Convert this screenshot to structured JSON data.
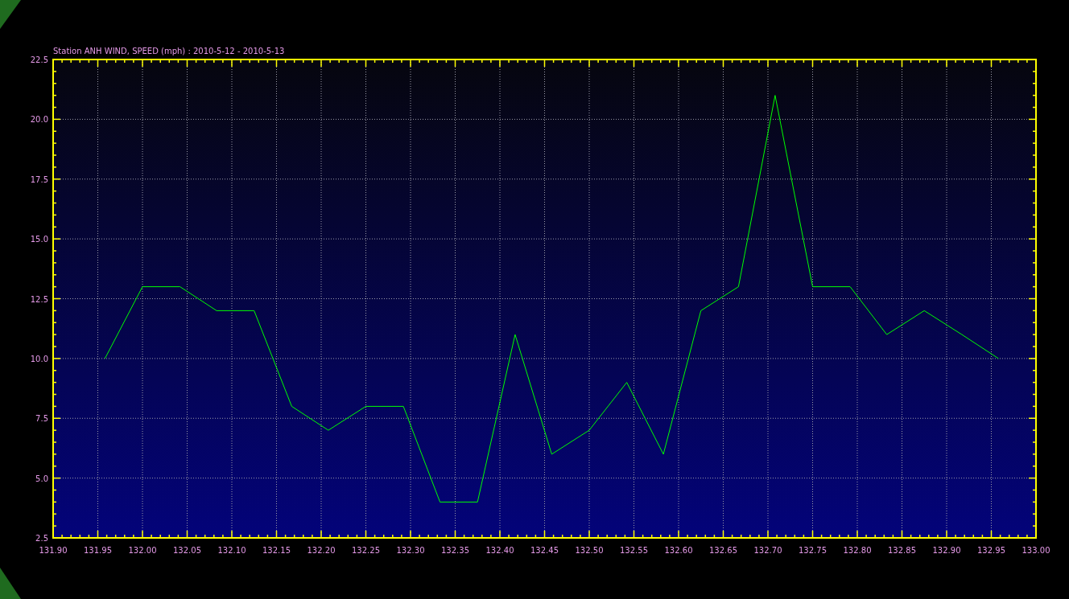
{
  "chart": {
    "chart_data": {
      "type": "line",
      "grid": true,
      "title": "Station ANH WIND, SPEED (mph) : 2010-5-12 - 2010-5-13",
      "x": [
        131.958,
        132.0,
        132.042,
        132.083,
        132.125,
        132.167,
        132.208,
        132.25,
        132.292,
        132.333,
        132.375,
        132.417,
        132.458,
        132.5,
        132.542,
        132.583,
        132.625,
        132.667,
        132.708,
        132.75,
        132.792,
        132.833,
        132.875,
        132.917,
        132.958
      ],
      "series": [
        {
          "color": "#00ff00",
          "values": [
            10,
            13,
            13,
            12,
            12,
            8,
            7,
            8,
            8,
            4,
            4,
            11,
            6,
            7,
            9,
            6,
            12,
            13,
            21,
            13,
            13,
            11,
            12,
            11,
            10
          ]
        }
      ],
      "xlim": [
        131.9,
        133.0
      ],
      "ylim": [
        2.5,
        22.5
      ],
      "xticks": [
        {
          "value": 131.9,
          "label": "131.90"
        },
        {
          "value": 131.95,
          "label": "131.95"
        },
        {
          "value": 132.0,
          "label": "132.00"
        },
        {
          "value": 132.05,
          "label": "132.05"
        },
        {
          "value": 132.1,
          "label": "132.10"
        },
        {
          "value": 132.15,
          "label": "132.15"
        },
        {
          "value": 132.2,
          "label": "132.20"
        },
        {
          "value": 132.25,
          "label": "132.25"
        },
        {
          "value": 132.3,
          "label": "132.30"
        },
        {
          "value": 132.35,
          "label": "132.35"
        },
        {
          "value": 132.4,
          "label": "132.40"
        },
        {
          "value": 132.45,
          "label": "132.45"
        },
        {
          "value": 132.5,
          "label": "132.50"
        },
        {
          "value": 132.55,
          "label": "132.55"
        },
        {
          "value": 132.6,
          "label": "132.60"
        },
        {
          "value": 132.65,
          "label": "132.65"
        },
        {
          "value": 132.7,
          "label": "132.70"
        },
        {
          "value": 132.75,
          "label": "132.75"
        },
        {
          "value": 132.8,
          "label": "132.80"
        },
        {
          "value": 132.85,
          "label": "132.85"
        },
        {
          "value": 132.9,
          "label": "132.90"
        },
        {
          "value": 132.95,
          "label": "132.95"
        },
        {
          "value": 133.0,
          "label": "133.00"
        }
      ],
      "yticks": [
        {
          "value": 2.5,
          "label": "2.5"
        },
        {
          "value": 5,
          "label": "5.0"
        },
        {
          "value": 7.5,
          "label": "7.5"
        },
        {
          "value": 10,
          "label": "10.0"
        },
        {
          "value": 12.5,
          "label": "12.5"
        },
        {
          "value": 15,
          "label": "15.0"
        },
        {
          "value": 17.5,
          "label": "17.5"
        },
        {
          "value": 20,
          "label": "20.0"
        },
        {
          "value": 22.5,
          "label": "22.5"
        }
      ]
    }
  }
}
